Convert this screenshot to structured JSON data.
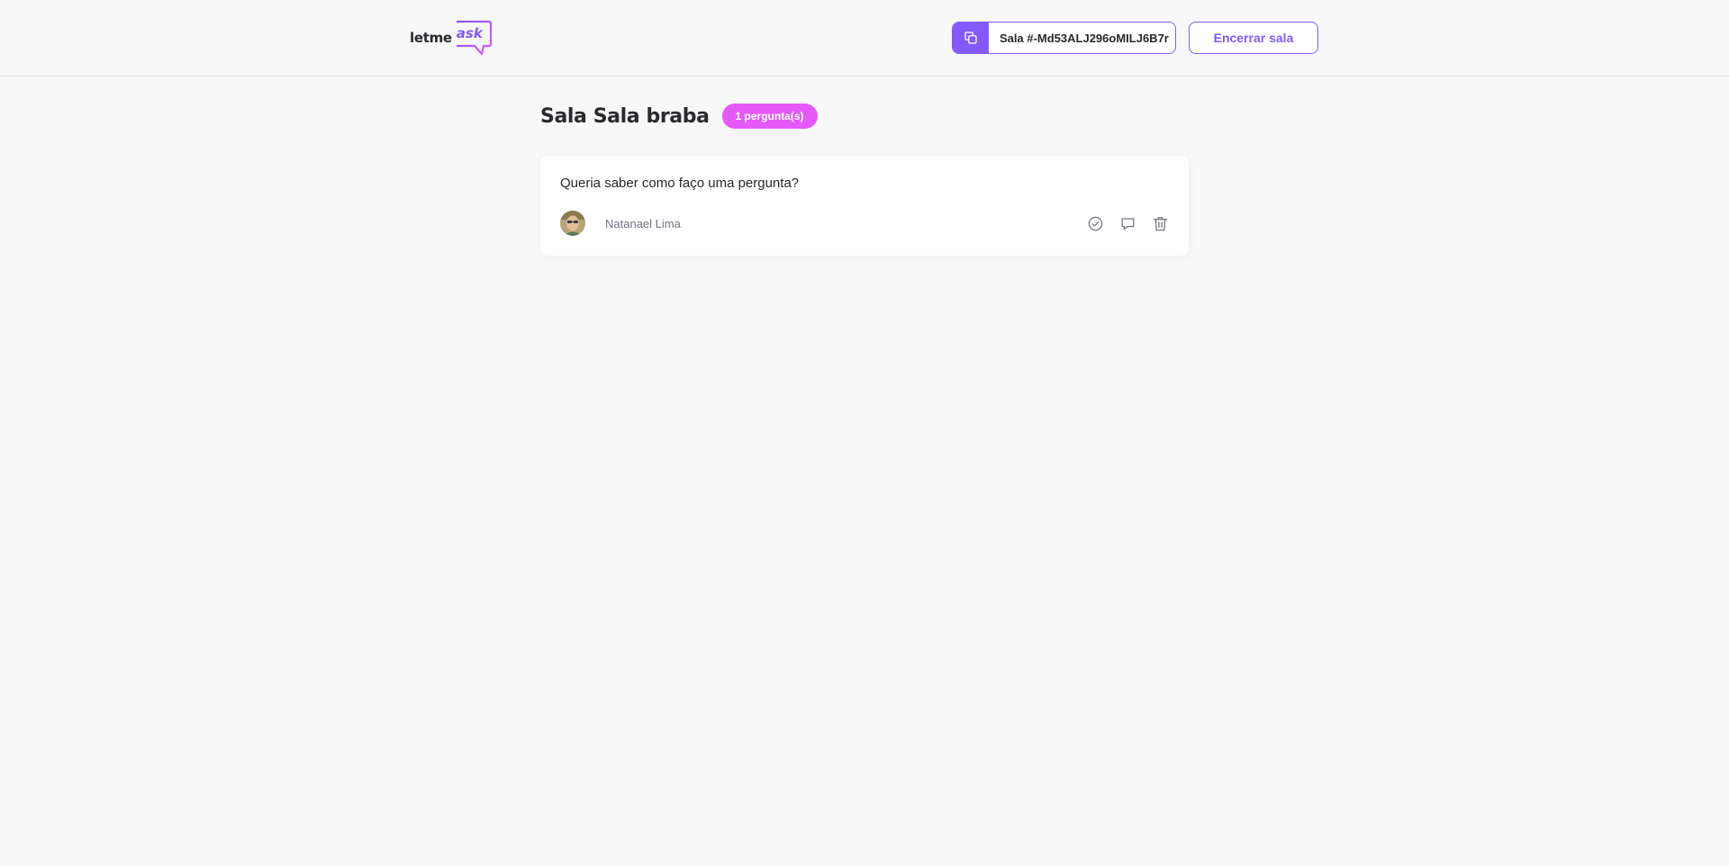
{
  "header": {
    "logo": {
      "text": "letme",
      "accent_text": "ask"
    },
    "room_code": {
      "label": "Sala #-Md53ALJ296oMILJ6B7r",
      "icon": "copy-icon"
    },
    "close_room_label": "Encerrar sala"
  },
  "room": {
    "title": "Sala Sala braba",
    "question_count": "1 pergunta(s)",
    "questions": [
      {
        "content": "Queria saber como faço uma pergunta?",
        "author": "Natanael Lima",
        "actions": [
          "check-circle-icon",
          "answer-icon",
          "delete-icon"
        ]
      }
    ]
  },
  "colors": {
    "primary": "#835afd",
    "pink": "#e559f9",
    "background": "#f8f8f8",
    "text": "#29292e",
    "muted": "#737380"
  }
}
